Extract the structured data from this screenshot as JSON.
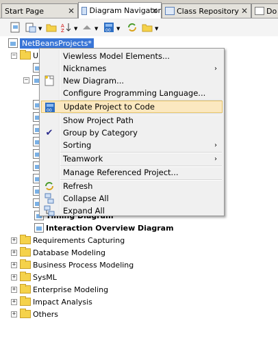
{
  "tabs": [
    {
      "label": "Start Page",
      "active": false
    },
    {
      "label": "Diagram Navigator",
      "active": true
    },
    {
      "label": "Class Repository",
      "active": false
    },
    {
      "label": "Do",
      "active": false
    }
  ],
  "tree": {
    "project": "NetBeansProjects*",
    "first_child": "UI",
    "visible_children": [
      {
        "label": "Timing Diagram",
        "bold": true
      },
      {
        "label": "Interaction Overview Diagram",
        "bold": true
      }
    ],
    "categories": [
      "Requirements Capturing",
      "Database Modeling",
      "Business Process Modeling",
      "SysML",
      "Enterprise Modeling",
      "Impact Analysis",
      "Others"
    ]
  },
  "context_menu": {
    "items": [
      {
        "label": "Viewless Model Elements...",
        "icon": "",
        "submenu": false
      },
      {
        "label": "Nicknames",
        "icon": "",
        "submenu": true
      },
      {
        "label": "New Diagram...",
        "icon": "new-diagram-icon",
        "submenu": false
      },
      {
        "label": "Configure Programming Language...",
        "icon": "",
        "submenu": false
      },
      {
        "label": "Update Project to Code",
        "icon": "update-code-icon",
        "submenu": false,
        "highlighted": true
      },
      {
        "label": "Show Project Path",
        "icon": "",
        "submenu": false
      },
      {
        "label": "Group by Category",
        "icon": "checkmark-icon",
        "submenu": false,
        "checked": true
      },
      {
        "label": "Sorting",
        "icon": "",
        "submenu": true
      },
      {
        "label": "Teamwork",
        "icon": "",
        "submenu": true
      },
      {
        "label": "Manage Referenced Project...",
        "icon": "",
        "submenu": false
      },
      {
        "label": "Refresh",
        "icon": "refresh-icon",
        "submenu": false
      },
      {
        "label": "Collapse All",
        "icon": "collapse-all-icon",
        "submenu": false
      },
      {
        "label": "Expand All",
        "icon": "expand-all-icon",
        "submenu": false
      }
    ]
  },
  "colors": {
    "selection": "#3875d7",
    "menu_highlight": "#fbe8c0",
    "folder": "#f5d24a"
  }
}
